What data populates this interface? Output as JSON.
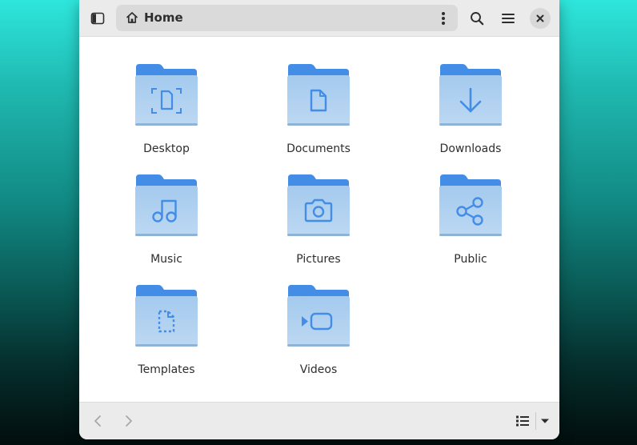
{
  "window": {
    "path": {
      "label": "Home",
      "icon": "home-icon"
    },
    "header_buttons": {
      "sidebar_toggle_icon": "sidebar-toggle-icon",
      "path_menu_icon": "vertical-dots-icon",
      "search_icon": "search-icon",
      "main_menu_icon": "hamburger-menu-icon",
      "close_icon": "close-icon"
    },
    "items": [
      {
        "label": "Desktop",
        "icon": "desktop-folder-icon"
      },
      {
        "label": "Documents",
        "icon": "documents-folder-icon"
      },
      {
        "label": "Downloads",
        "icon": "downloads-folder-icon"
      },
      {
        "label": "Music",
        "icon": "music-folder-icon"
      },
      {
        "label": "Pictures",
        "icon": "pictures-folder-icon"
      },
      {
        "label": "Public",
        "icon": "public-folder-icon"
      },
      {
        "label": "Templates",
        "icon": "templates-folder-icon"
      },
      {
        "label": "Videos",
        "icon": "videos-folder-icon"
      }
    ],
    "footer": {
      "back_icon": "chevron-left-icon",
      "forward_icon": "chevron-right-icon",
      "view_icon": "list-view-icon",
      "view_menu_icon": "dropdown-arrow-icon"
    }
  },
  "colors": {
    "folder_back": "#438de6",
    "folder_front_top": "#a4caee",
    "folder_front_bottom": "#b9d6f2",
    "folder_emblem": "#438de6",
    "header_bg": "#ebebeb",
    "content_bg": "#ffffff"
  }
}
